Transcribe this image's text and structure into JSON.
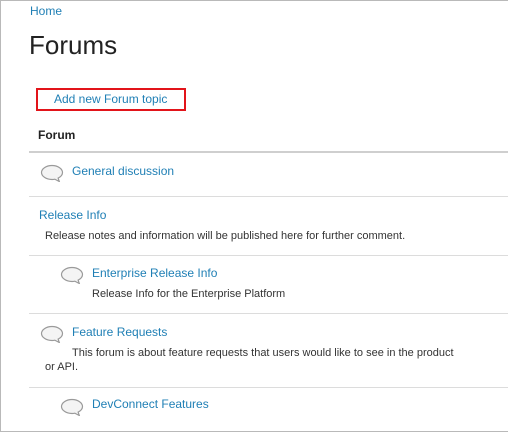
{
  "breadcrumb": {
    "home": "Home"
  },
  "page": {
    "title": "Forums",
    "add_topic_label": "Add new Forum topic"
  },
  "table": {
    "header": "Forum"
  },
  "forums": [
    {
      "title": "General discussion",
      "description": ""
    },
    {
      "title": "Release Info",
      "description": "Release notes and information will be published here for further comment."
    },
    {
      "title": "Enterprise Release Info",
      "description": "Release Info for the Enterprise Platform"
    },
    {
      "title": "Feature Requests",
      "description_line1": "This forum is about feature requests that users would like to see in the product",
      "description_line2": "or API."
    },
    {
      "title": "DevConnect Features",
      "description": ""
    }
  ],
  "colors": {
    "link": "#1f7fb5",
    "highlight_box": "#e2141a",
    "rule": "#dcdcdc"
  },
  "icons": {
    "forum": "speech-bubble-icon"
  }
}
